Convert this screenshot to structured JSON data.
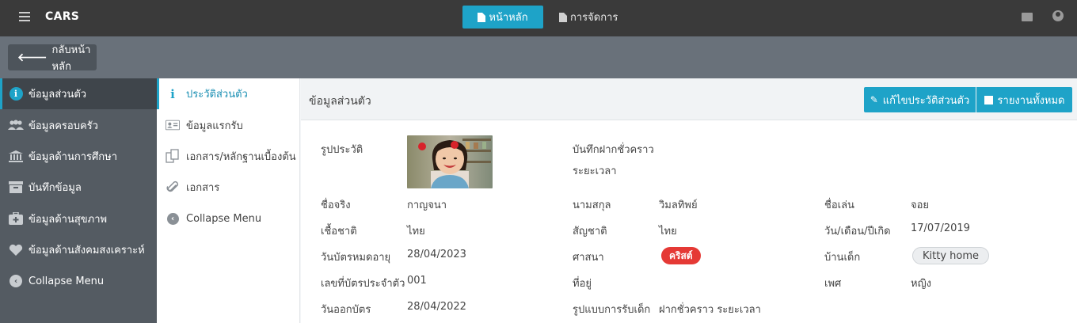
{
  "app": {
    "title": "CARS"
  },
  "topnav": {
    "home_label": "หน้าหลัก",
    "manage_label": "การจัดการ"
  },
  "backbar": {
    "back_label": "กลับหน้าหลัก"
  },
  "sidebar": {
    "items": [
      {
        "label": "ข้อมูลส่วนตัว",
        "icon": "info-icon"
      },
      {
        "label": "ข้อมูลครอบครัว",
        "icon": "users-icon"
      },
      {
        "label": "ข้อมูลด้านการศึกษา",
        "icon": "institution-icon"
      },
      {
        "label": "บันทึกข้อมูล",
        "icon": "archive-icon"
      },
      {
        "label": "ข้อมูลด้านสุขภาพ",
        "icon": "medkit-icon"
      },
      {
        "label": "ข้อมูลด้านสังคมสงเคราะห์",
        "icon": "heart-icon"
      },
      {
        "label": "Collapse Menu",
        "icon": "chevron-left-icon"
      }
    ]
  },
  "submenu": {
    "items": [
      {
        "label": "ประวัติส่วนตัว",
        "icon": "info-icon"
      },
      {
        "label": "ข้อมูลแรกรับ",
        "icon": "id-card-icon"
      },
      {
        "label": "เอกสาร/หลักฐานเบื้องต้น",
        "icon": "copy-icon"
      },
      {
        "label": "เอกสาร",
        "icon": "paperclip-icon"
      },
      {
        "label": "Collapse Menu",
        "icon": "chevron-left-icon"
      }
    ]
  },
  "main": {
    "title": "ข้อมูลส่วนตัว",
    "edit_label": "แก้ไขประวัติส่วนตัว",
    "report_label": "รายงานทั้งหมด",
    "fields": {
      "photo_label": "รูปประวัติ",
      "deposit_label": "บันทึกฝากชั่วคราว",
      "duration_label": "ระยะเวลา",
      "firstname_label": "ชื่อจริง",
      "firstname_value": "กาญจนา",
      "lastname_label": "นามสกุล",
      "lastname_value": "วิมลทิพย์",
      "nickname_label": "ชื่อเล่น",
      "nickname_value": "จอย",
      "ethnicity_label": "เชื้อชาติ",
      "ethnicity_value": "ไทย",
      "nationality_label": "สัญชาติ",
      "nationality_value": "ไทย",
      "dob_label": "วัน/เดือน/ปีเกิด",
      "dob_value": "17/07/2019",
      "expiry_label": "วันบัตรหมดอายุ",
      "expiry_value": "28/04/2023",
      "religion_label": "ศาสนา",
      "religion_value": "คริสต์",
      "home_label": "บ้านเด็ก",
      "home_value": "Kitty home",
      "idcard_label": "เลขที่บัตรประจำตัว",
      "idcard_value": "001",
      "address_label": "ที่อยู่",
      "gender_label": "เพศ",
      "gender_value": "หญิง",
      "issue_label": "วันออกบัตร",
      "issue_value": "28/04/2022",
      "intake_label": "รูปแบบการรับเด็ก",
      "intake_value": "ฝากชั่วคราว ระยะเวลา"
    }
  }
}
